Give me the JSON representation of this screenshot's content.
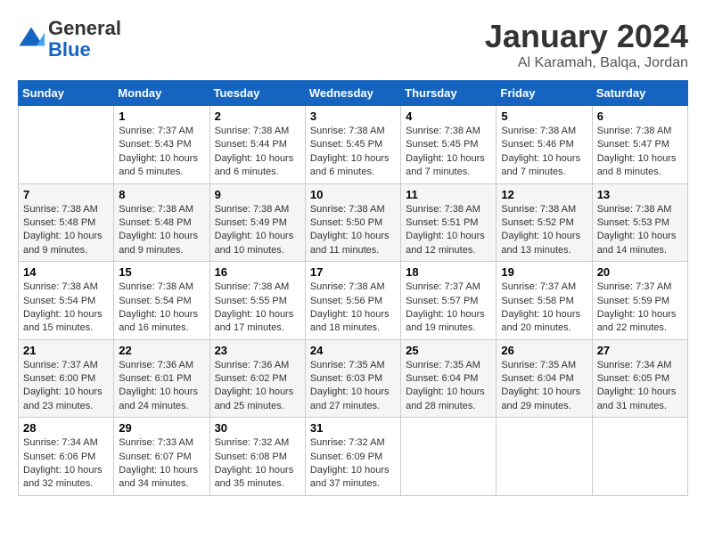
{
  "header": {
    "logo_line1": "General",
    "logo_line2": "Blue",
    "month": "January 2024",
    "location": "Al Karamah, Balqa, Jordan"
  },
  "columns": [
    "Sunday",
    "Monday",
    "Tuesday",
    "Wednesday",
    "Thursday",
    "Friday",
    "Saturday"
  ],
  "weeks": [
    [
      {
        "day": "",
        "info": ""
      },
      {
        "day": "1",
        "info": "Sunrise: 7:37 AM\nSunset: 5:43 PM\nDaylight: 10 hours\nand 5 minutes."
      },
      {
        "day": "2",
        "info": "Sunrise: 7:38 AM\nSunset: 5:44 PM\nDaylight: 10 hours\nand 6 minutes."
      },
      {
        "day": "3",
        "info": "Sunrise: 7:38 AM\nSunset: 5:45 PM\nDaylight: 10 hours\nand 6 minutes."
      },
      {
        "day": "4",
        "info": "Sunrise: 7:38 AM\nSunset: 5:45 PM\nDaylight: 10 hours\nand 7 minutes."
      },
      {
        "day": "5",
        "info": "Sunrise: 7:38 AM\nSunset: 5:46 PM\nDaylight: 10 hours\nand 7 minutes."
      },
      {
        "day": "6",
        "info": "Sunrise: 7:38 AM\nSunset: 5:47 PM\nDaylight: 10 hours\nand 8 minutes."
      }
    ],
    [
      {
        "day": "7",
        "info": "Sunrise: 7:38 AM\nSunset: 5:48 PM\nDaylight: 10 hours\nand 9 minutes."
      },
      {
        "day": "8",
        "info": "Sunrise: 7:38 AM\nSunset: 5:48 PM\nDaylight: 10 hours\nand 9 minutes."
      },
      {
        "day": "9",
        "info": "Sunrise: 7:38 AM\nSunset: 5:49 PM\nDaylight: 10 hours\nand 10 minutes."
      },
      {
        "day": "10",
        "info": "Sunrise: 7:38 AM\nSunset: 5:50 PM\nDaylight: 10 hours\nand 11 minutes."
      },
      {
        "day": "11",
        "info": "Sunrise: 7:38 AM\nSunset: 5:51 PM\nDaylight: 10 hours\nand 12 minutes."
      },
      {
        "day": "12",
        "info": "Sunrise: 7:38 AM\nSunset: 5:52 PM\nDaylight: 10 hours\nand 13 minutes."
      },
      {
        "day": "13",
        "info": "Sunrise: 7:38 AM\nSunset: 5:53 PM\nDaylight: 10 hours\nand 14 minutes."
      }
    ],
    [
      {
        "day": "14",
        "info": "Sunrise: 7:38 AM\nSunset: 5:54 PM\nDaylight: 10 hours\nand 15 minutes."
      },
      {
        "day": "15",
        "info": "Sunrise: 7:38 AM\nSunset: 5:54 PM\nDaylight: 10 hours\nand 16 minutes."
      },
      {
        "day": "16",
        "info": "Sunrise: 7:38 AM\nSunset: 5:55 PM\nDaylight: 10 hours\nand 17 minutes."
      },
      {
        "day": "17",
        "info": "Sunrise: 7:38 AM\nSunset: 5:56 PM\nDaylight: 10 hours\nand 18 minutes."
      },
      {
        "day": "18",
        "info": "Sunrise: 7:37 AM\nSunset: 5:57 PM\nDaylight: 10 hours\nand 19 minutes."
      },
      {
        "day": "19",
        "info": "Sunrise: 7:37 AM\nSunset: 5:58 PM\nDaylight: 10 hours\nand 20 minutes."
      },
      {
        "day": "20",
        "info": "Sunrise: 7:37 AM\nSunset: 5:59 PM\nDaylight: 10 hours\nand 22 minutes."
      }
    ],
    [
      {
        "day": "21",
        "info": "Sunrise: 7:37 AM\nSunset: 6:00 PM\nDaylight: 10 hours\nand 23 minutes."
      },
      {
        "day": "22",
        "info": "Sunrise: 7:36 AM\nSunset: 6:01 PM\nDaylight: 10 hours\nand 24 minutes."
      },
      {
        "day": "23",
        "info": "Sunrise: 7:36 AM\nSunset: 6:02 PM\nDaylight: 10 hours\nand 25 minutes."
      },
      {
        "day": "24",
        "info": "Sunrise: 7:35 AM\nSunset: 6:03 PM\nDaylight: 10 hours\nand 27 minutes."
      },
      {
        "day": "25",
        "info": "Sunrise: 7:35 AM\nSunset: 6:04 PM\nDaylight: 10 hours\nand 28 minutes."
      },
      {
        "day": "26",
        "info": "Sunrise: 7:35 AM\nSunset: 6:04 PM\nDaylight: 10 hours\nand 29 minutes."
      },
      {
        "day": "27",
        "info": "Sunrise: 7:34 AM\nSunset: 6:05 PM\nDaylight: 10 hours\nand 31 minutes."
      }
    ],
    [
      {
        "day": "28",
        "info": "Sunrise: 7:34 AM\nSunset: 6:06 PM\nDaylight: 10 hours\nand 32 minutes."
      },
      {
        "day": "29",
        "info": "Sunrise: 7:33 AM\nSunset: 6:07 PM\nDaylight: 10 hours\nand 34 minutes."
      },
      {
        "day": "30",
        "info": "Sunrise: 7:32 AM\nSunset: 6:08 PM\nDaylight: 10 hours\nand 35 minutes."
      },
      {
        "day": "31",
        "info": "Sunrise: 7:32 AM\nSunset: 6:09 PM\nDaylight: 10 hours\nand 37 minutes."
      },
      {
        "day": "",
        "info": ""
      },
      {
        "day": "",
        "info": ""
      },
      {
        "day": "",
        "info": ""
      }
    ]
  ]
}
